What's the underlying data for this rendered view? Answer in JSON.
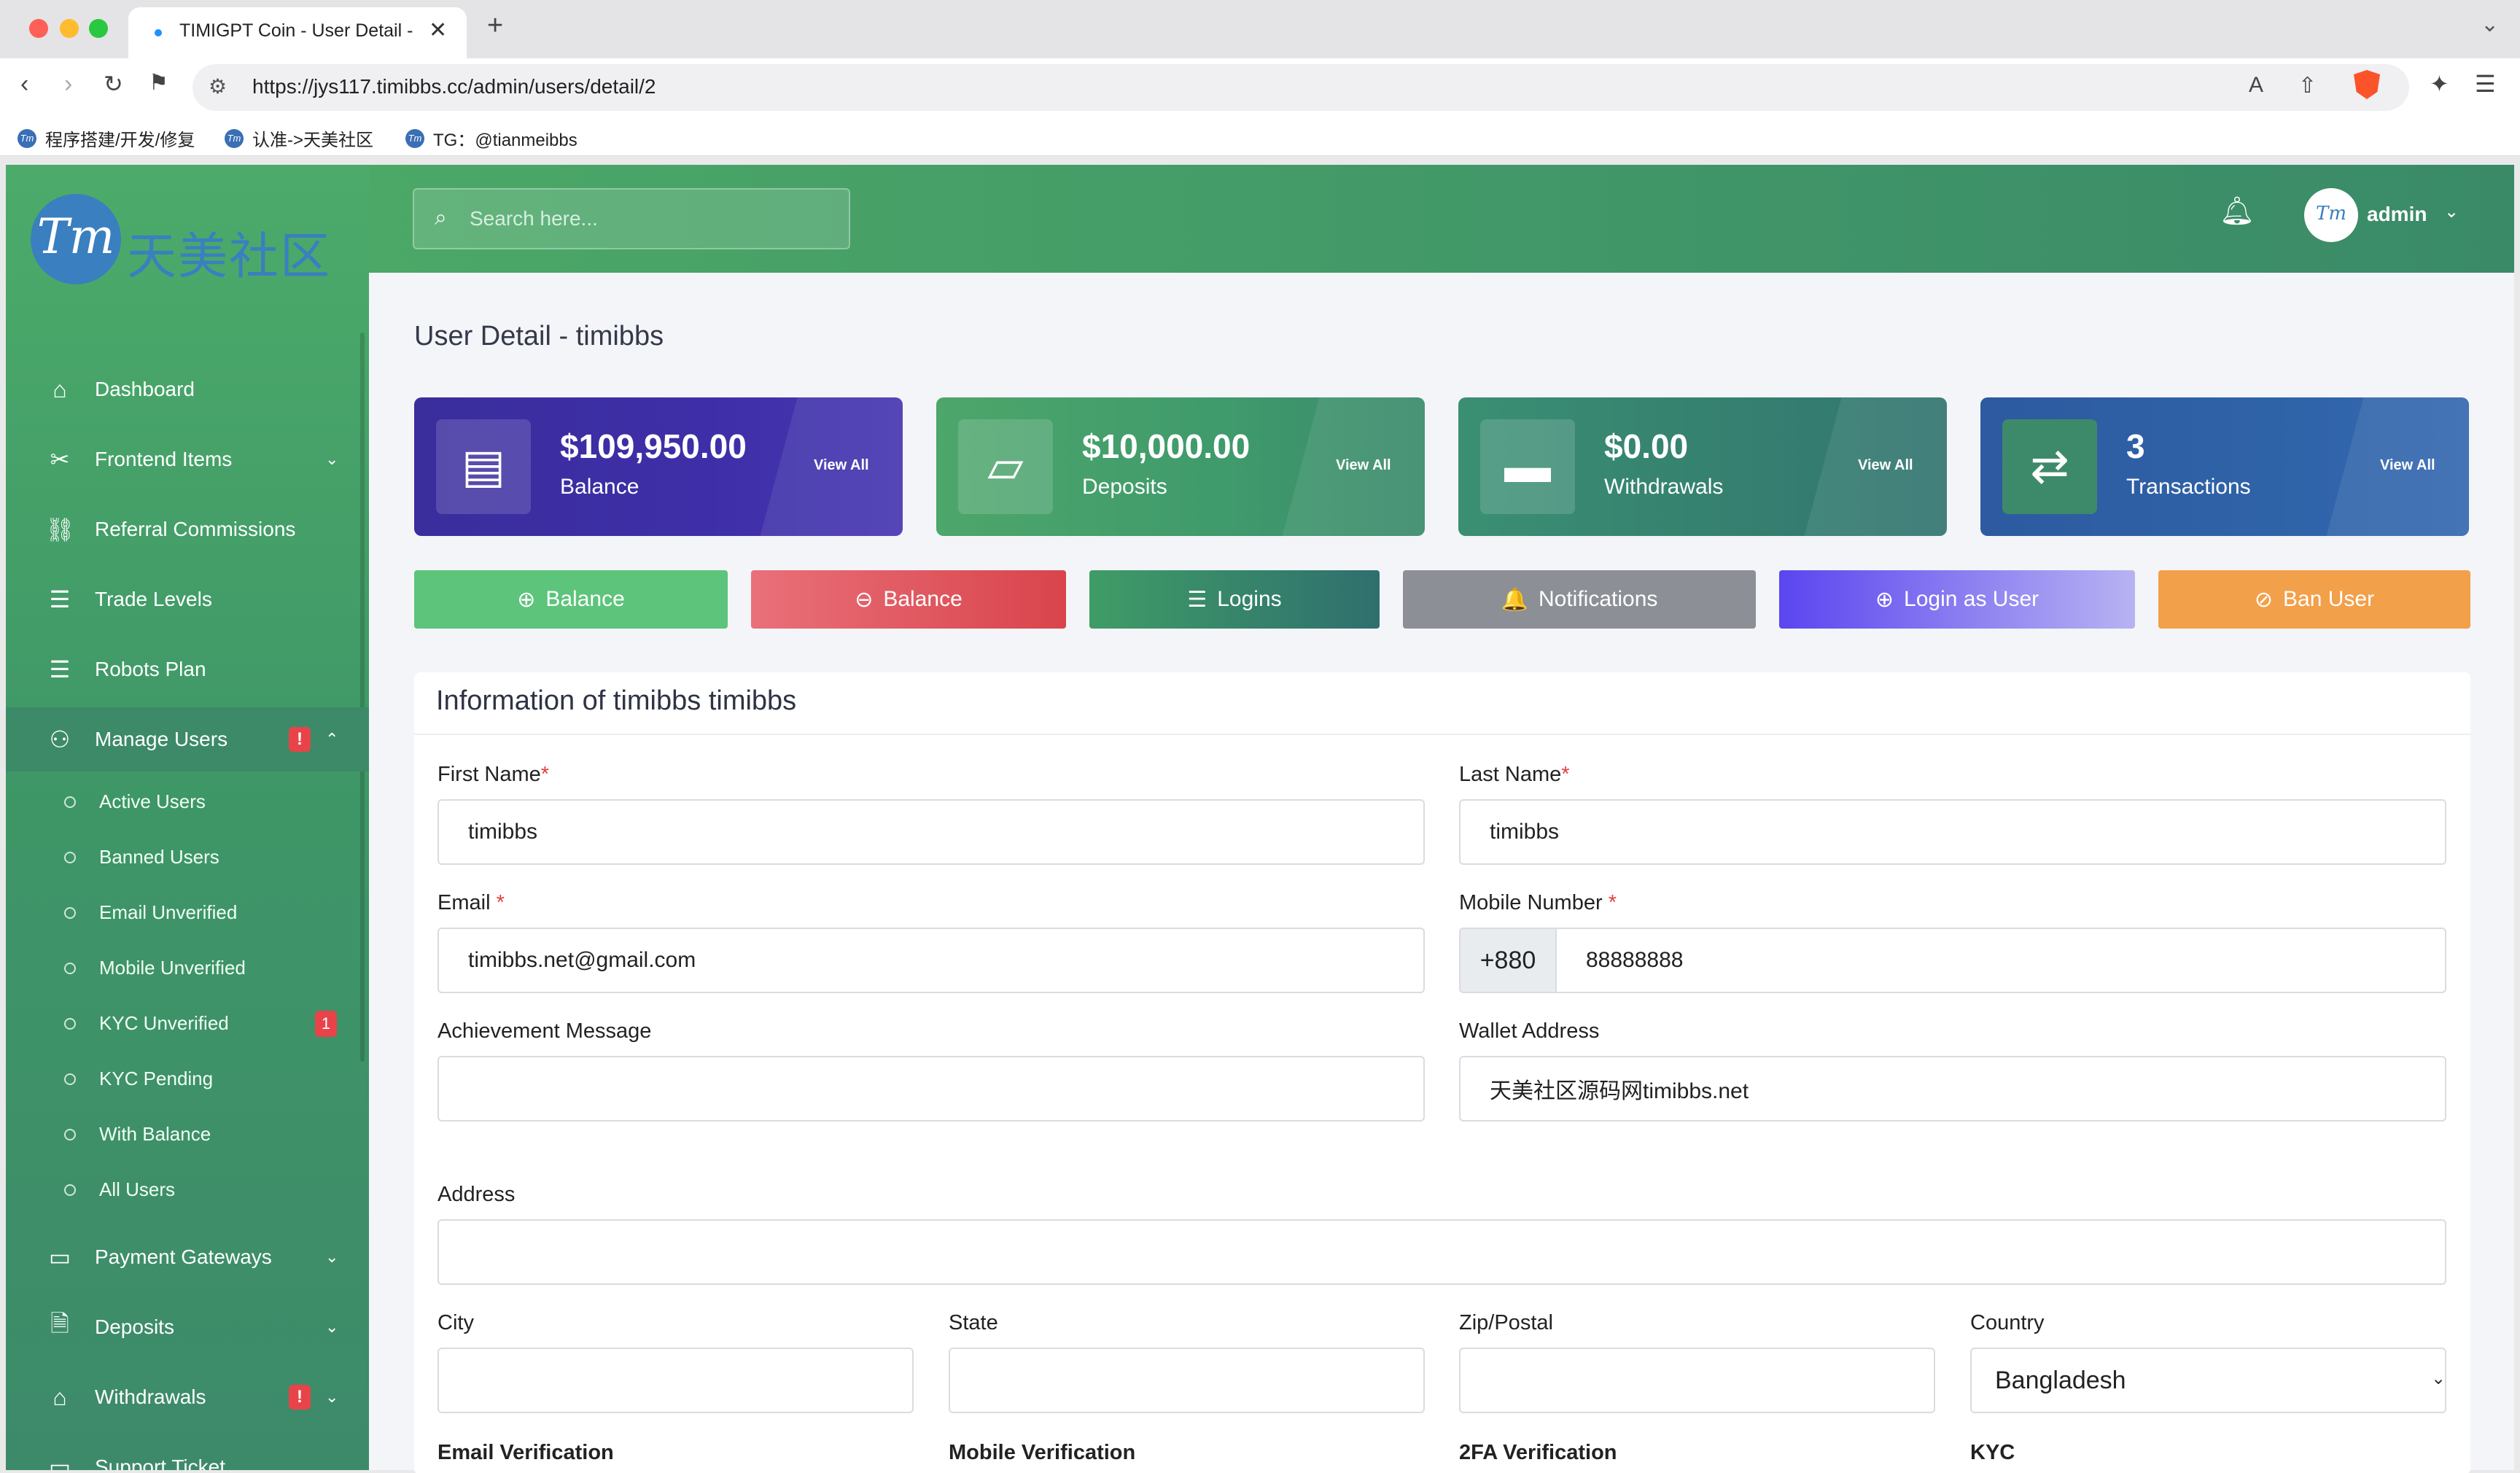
{
  "browser": {
    "tab_title": "TIMIGPT Coin - User Detail -",
    "url": "https://jys117.timibbs.cc/admin/users/detail/2",
    "bookmarks": [
      "程序搭建/开发/修复",
      "认准->天美社区",
      "TG：@tianmeibbs"
    ]
  },
  "brand": {
    "logo_mark": "Tm",
    "logo_text": "天美社区"
  },
  "sidebar": {
    "items": [
      {
        "label": "Dashboard",
        "icon": "home-icon"
      },
      {
        "label": "Frontend Items",
        "icon": "tools-icon",
        "has_chevron": true
      },
      {
        "label": "Referral Commissions",
        "icon": "link-icon"
      },
      {
        "label": "Trade Levels",
        "icon": "list-icon"
      },
      {
        "label": "Robots Plan",
        "icon": "list-icon"
      },
      {
        "label": "Manage Users",
        "icon": "users-icon",
        "badge": "!",
        "expanded": true
      }
    ],
    "subitems": [
      {
        "label": "Active Users"
      },
      {
        "label": "Banned Users"
      },
      {
        "label": "Email Unverified"
      },
      {
        "label": "Mobile Unverified"
      },
      {
        "label": "KYC Unverified",
        "badge": "1"
      },
      {
        "label": "KYC Pending"
      },
      {
        "label": "With Balance"
      },
      {
        "label": "All Users"
      }
    ],
    "items_after": [
      {
        "label": "Payment Gateways",
        "icon": "card-icon"
      },
      {
        "label": "Deposits",
        "icon": "receipt-icon"
      },
      {
        "label": "Withdrawals",
        "icon": "bank-icon",
        "badge": "!"
      },
      {
        "label": "Support Ticket",
        "icon": "ticket-icon"
      }
    ]
  },
  "header": {
    "search_placeholder": "Search here...",
    "user_name": "admin",
    "avatar_mark": "Tm"
  },
  "page": {
    "title": "User Detail - timibbs"
  },
  "stats": [
    {
      "amount": "$109,950.00",
      "label": "Balance",
      "link": "View All",
      "icon": "money-icon"
    },
    {
      "amount": "$10,000.00",
      "label": "Deposits",
      "link": "View All",
      "icon": "wallet-icon"
    },
    {
      "amount": "$0.00",
      "label": "Withdrawals",
      "link": "View All",
      "icon": "wallet-icon"
    },
    {
      "amount": "3",
      "label": "Transactions",
      "link": "View All",
      "icon": "exchange-icon"
    }
  ],
  "actions": [
    {
      "label": "Balance",
      "icon": "⊕"
    },
    {
      "label": "Balance",
      "icon": "⊖"
    },
    {
      "label": "Logins",
      "icon": "☰"
    },
    {
      "label": "Notifications",
      "icon": "🔔"
    },
    {
      "label": "Login as User",
      "icon": "⊕"
    },
    {
      "label": "Ban User",
      "icon": "⊘"
    }
  ],
  "form": {
    "heading": "Information of timibbs timibbs",
    "first_name_label": "First Name",
    "first_name": "timibbs",
    "last_name_label": "Last Name",
    "last_name": "timibbs",
    "email_label": "Email",
    "email": "timibbs.net@gmail.com",
    "mobile_label": "Mobile Number",
    "mobile_prefix": "+880",
    "mobile": "88888888",
    "achievement_label": "Achievement Message",
    "achievement": "",
    "wallet_label": "Wallet Address",
    "wallet": "天美社区源码网timibbs.net",
    "address_label": "Address",
    "address": "",
    "city_label": "City",
    "state_label": "State",
    "zip_label": "Zip/Postal",
    "country_label": "Country",
    "country": "Bangladesh",
    "email_verif_label": "Email Verification",
    "mobile_verif_label": "Mobile Verification",
    "twofa_label": "2FA Verification",
    "kyc_label": "KYC"
  },
  "colors": {
    "sidebar_green": "#4cab6a",
    "balance_card": "#3a2d9c",
    "deposits_card": "#4a9f68",
    "withdrawals_card": "#3a8f72",
    "transactions_card": "#2d5aa0",
    "add_balance_btn": "#5dc47b",
    "sub_balance_btn": "#e05a62",
    "notifications_btn": "#8c9096",
    "login_as_user_btn": "#6b5ef0",
    "ban_user_btn": "#f2a04a"
  }
}
